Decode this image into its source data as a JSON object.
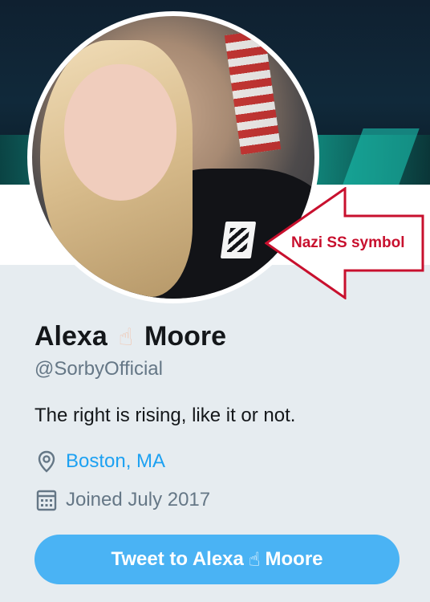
{
  "annotation": {
    "label": "Nazi SS symbol",
    "color": "#c8102e"
  },
  "profile": {
    "name_first": "Alexa",
    "name_emoji": "☝",
    "name_last": "Moore",
    "handle": "@SorbyOfficial",
    "bio": "The right is rising, like it or not.",
    "location": "Boston, MA",
    "joined": "Joined July 2017",
    "location_icon": "location-pin-icon",
    "joined_icon": "calendar-icon"
  },
  "tweet_button": {
    "label_prefix": "Tweet to Alexa",
    "label_emoji": "☝",
    "label_suffix": "Moore"
  },
  "colors": {
    "accent_blue": "#1da1f2",
    "button_blue": "#4ab3f4",
    "page_background": "#e6ecf0",
    "text_dark": "#14171a",
    "text_muted": "#657786"
  }
}
